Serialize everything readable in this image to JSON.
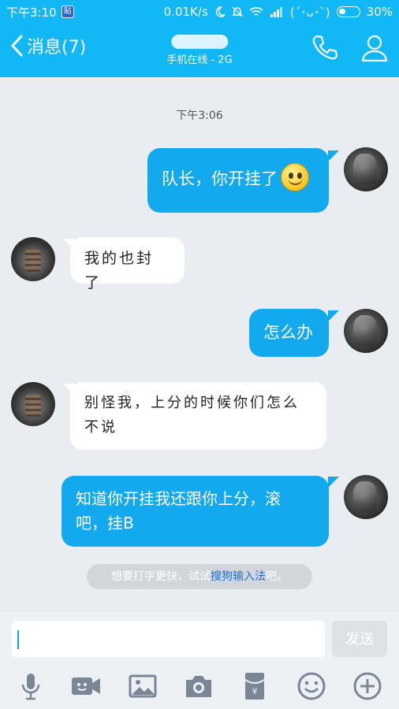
{
  "status_bar": {
    "time": "下午3:10",
    "app_badge": "贴",
    "speed": "0.01K/s",
    "emoticon": "(´･ᴗ･`)",
    "battery": "30%"
  },
  "nav": {
    "back_label": "消息(7)",
    "contact_name": "",
    "online_status": "手机在线 - 2G"
  },
  "timestamp": "下午3:06",
  "messages": [
    {
      "from": "me",
      "text": "队长，你开挂了"
    },
    {
      "from": "other",
      "text": "我的也封了"
    },
    {
      "from": "me",
      "text": "怎么办"
    },
    {
      "from": "other",
      "line1": "别怪我，上分的时候你们怎么",
      "line2": "不说"
    },
    {
      "from": "me",
      "line1": "知道你开挂我还跟你上分，滚",
      "line2": "吧，挂B"
    }
  ],
  "ime_tip": {
    "prefix": "想要打字更快，试试",
    "link": "搜狗输入法",
    "suffix": "吧。"
  },
  "composer": {
    "placeholder": "",
    "send_label": "发送"
  },
  "colors": {
    "accent": "#12b7f5",
    "bubble_me": "#12a9ee",
    "bubble_other": "#ffffff",
    "background": "#e9edf1"
  },
  "toolbar_icons": [
    "mic-icon",
    "video-icon",
    "image-icon",
    "camera-icon",
    "red-packet-icon",
    "emoji-icon",
    "plus-icon"
  ]
}
